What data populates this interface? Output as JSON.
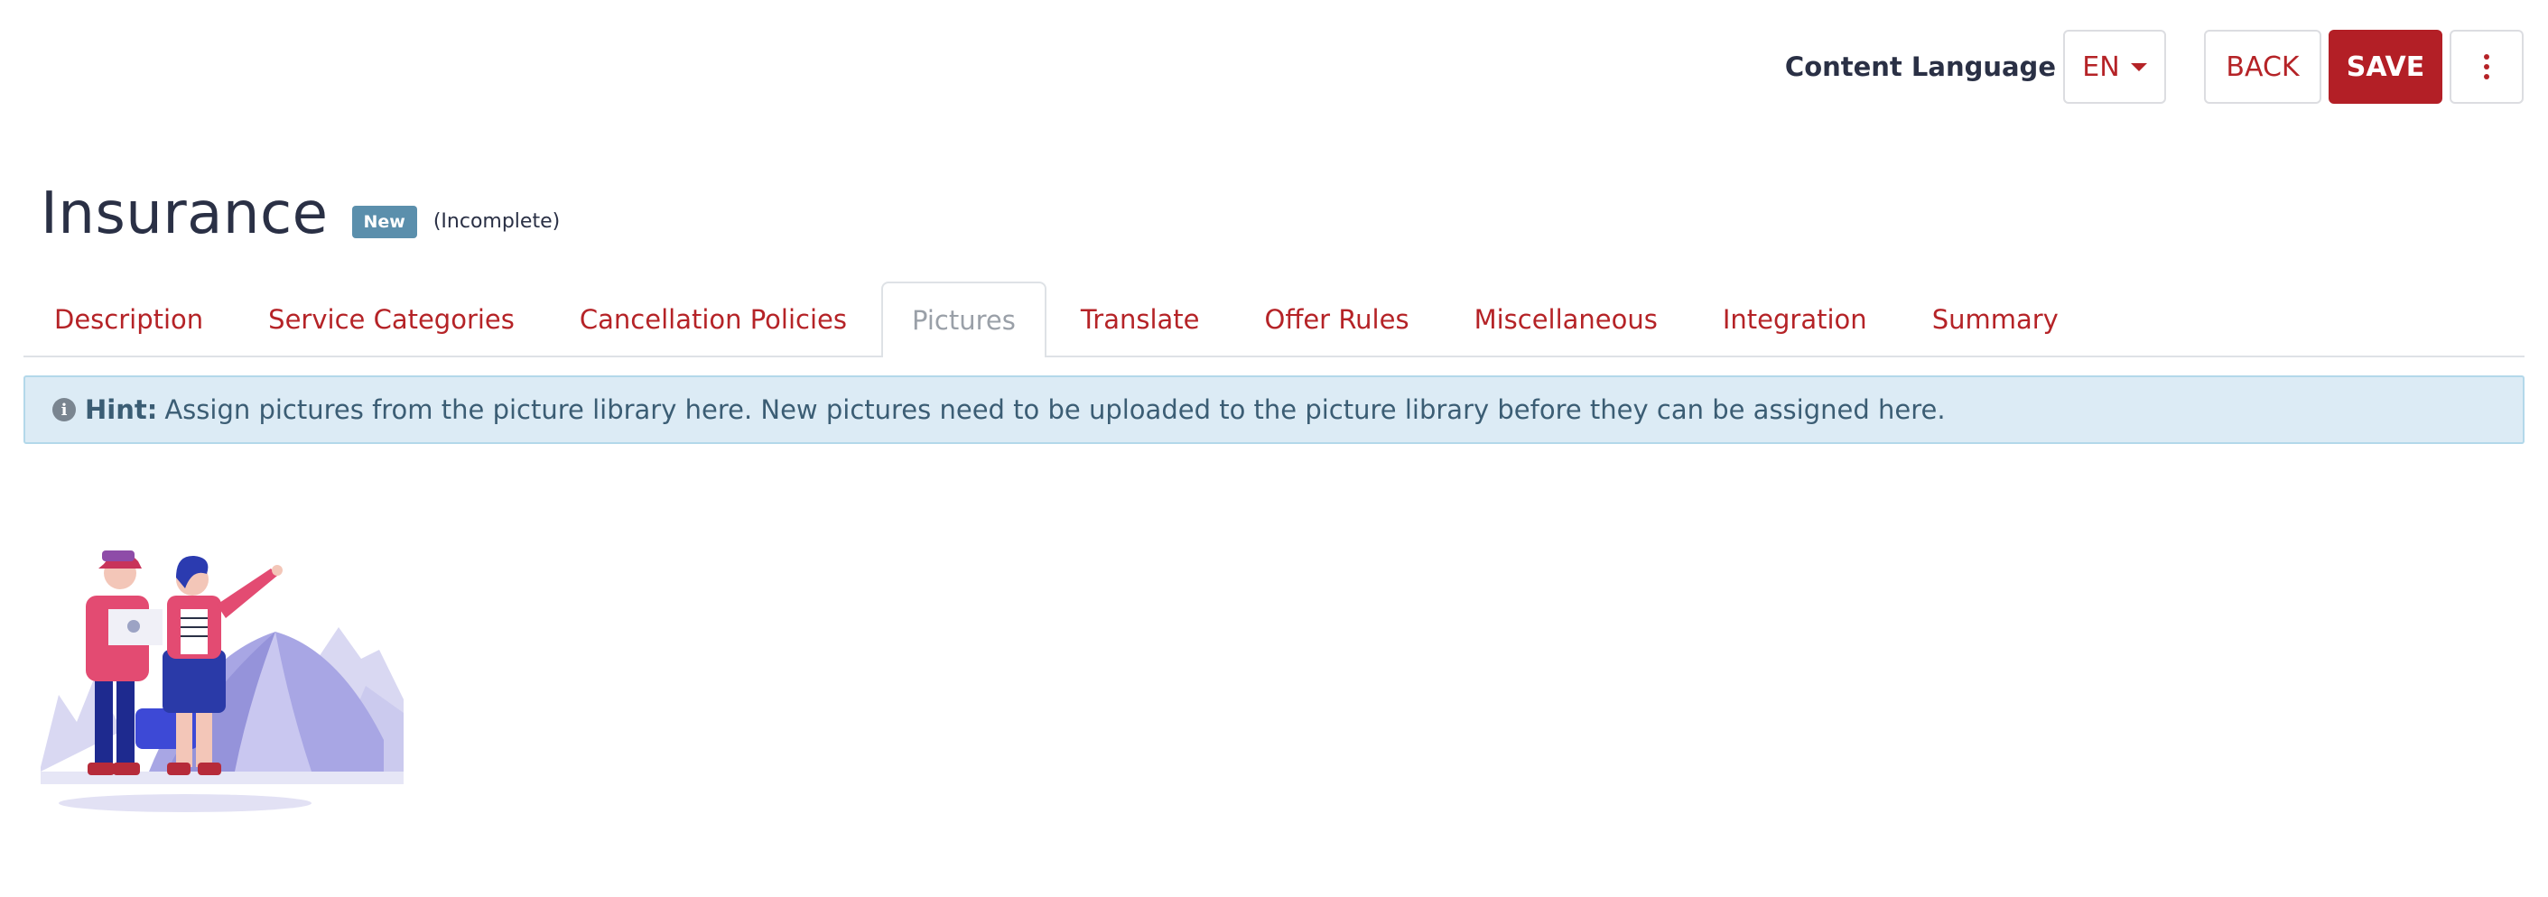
{
  "header": {
    "content_language_label": "Content Language",
    "language_value": "EN",
    "back_label": "BACK",
    "save_label": "SAVE"
  },
  "page": {
    "title": "Insurance",
    "badge": "New",
    "status": "(Incomplete)"
  },
  "tabs": [
    {
      "label": "Description",
      "active": false
    },
    {
      "label": "Service Categories",
      "active": false
    },
    {
      "label": "Cancellation Policies",
      "active": false
    },
    {
      "label": "Pictures",
      "active": true
    },
    {
      "label": "Translate",
      "active": false
    },
    {
      "label": "Offer Rules",
      "active": false
    },
    {
      "label": "Miscellaneous",
      "active": false
    },
    {
      "label": "Integration",
      "active": false
    },
    {
      "label": "Summary",
      "active": false
    }
  ],
  "hint": {
    "title": "Hint:",
    "text": "Assign pictures from the picture library here. New pictures need to be uploaded to the picture library before they can be assigned here."
  },
  "picture": {
    "icon": "travel-illustration"
  },
  "colors": {
    "accent": "#b52327",
    "save_bg": "#b31f26",
    "badge": "#5b8fac",
    "hint_bg": "#dcebf5"
  }
}
